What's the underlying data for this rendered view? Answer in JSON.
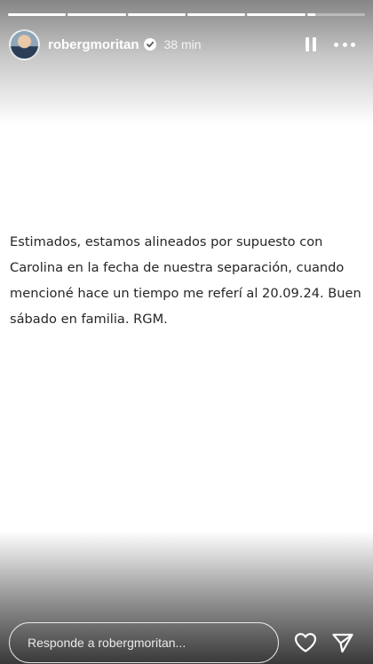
{
  "story": {
    "progress": {
      "segments": [
        1,
        1,
        1,
        1,
        1,
        0.15
      ]
    },
    "header": {
      "username": "robergmoritan",
      "verified": true,
      "time_ago": "38 min",
      "pause_icon": "pause-icon",
      "more_icon": "more-options-icon"
    },
    "content": {
      "text": "Estimados, estamos alineados por supuesto con Carolina en la fecha de nuestra separación, cuando mencioné hace un tiempo me referí al 20.09.24. Buen sábado en familia. RGM."
    },
    "footer": {
      "reply_placeholder": "Responde a robergmoritan...",
      "like_icon": "heart-icon",
      "send_icon": "send-icon"
    }
  },
  "colors": {
    "text": "#262626",
    "overlay_text": "#ffffff",
    "background": "#ffffff"
  }
}
